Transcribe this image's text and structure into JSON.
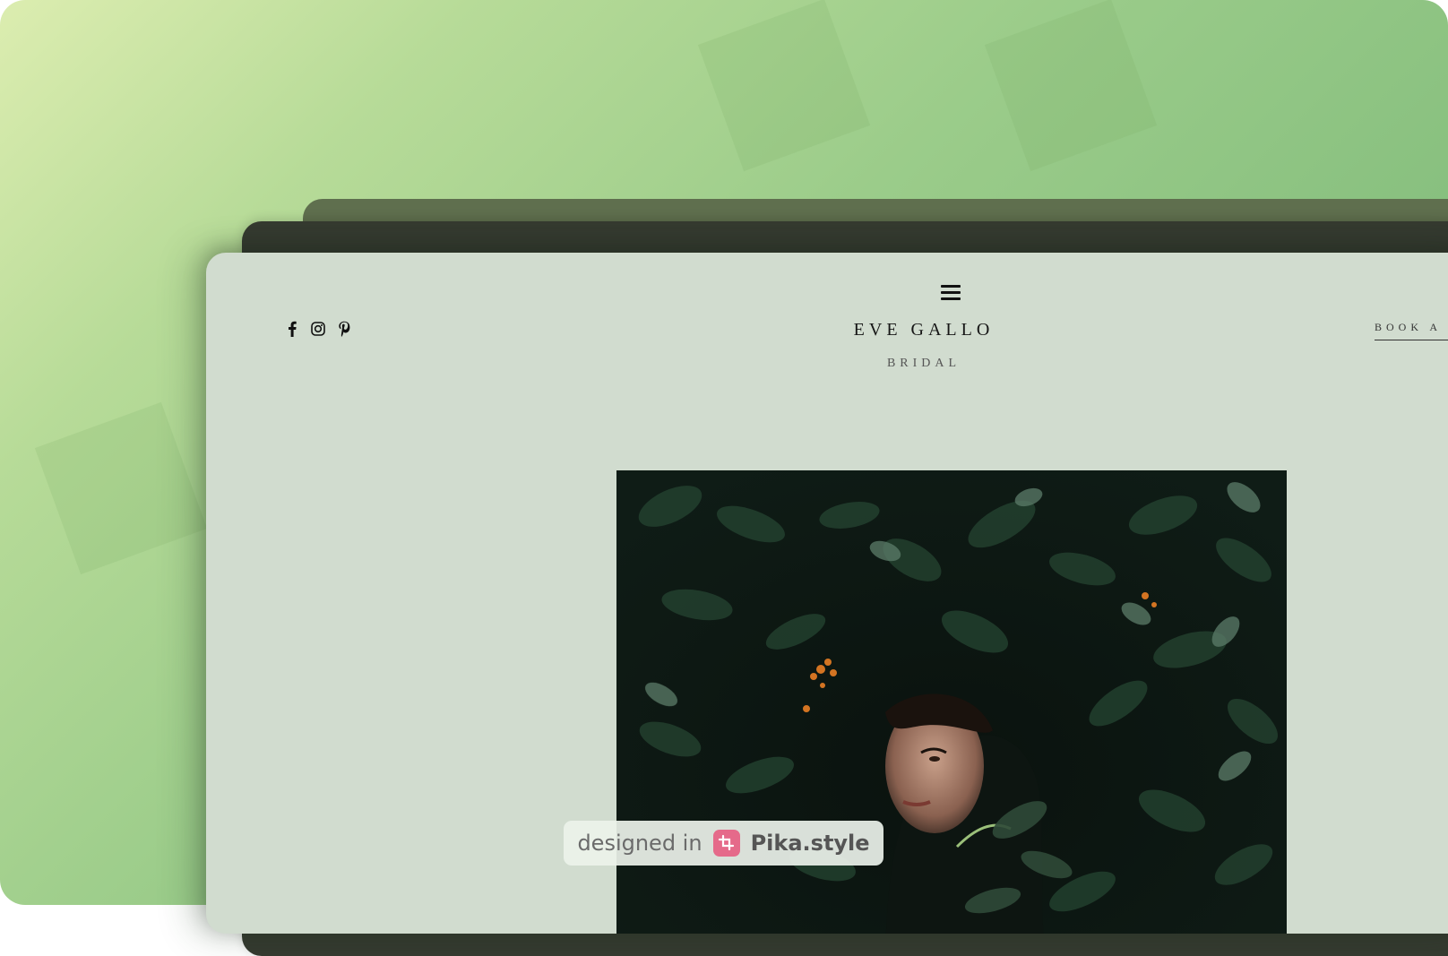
{
  "site": {
    "brand_name": "EVE GALLO",
    "brand_tagline": "BRIDAL",
    "cta_label": "BOOK A",
    "social": [
      {
        "name": "facebook",
        "icon": "facebook-icon"
      },
      {
        "name": "instagram",
        "icon": "instagram-icon"
      },
      {
        "name": "pinterest",
        "icon": "pinterest-icon"
      }
    ],
    "menu_icon": "hamburger-menu-icon",
    "hero_image": "woman-in-foliage-photo"
  },
  "watermark": {
    "prefix": "designed in",
    "brand": "Pika.style",
    "icon": "crop-icon"
  },
  "colors": {
    "page_bg": "#d1dccf",
    "frame_gradient_start": "#dcedb0",
    "frame_gradient_end": "#7bb777",
    "text": "#161616",
    "badge_logo": "#e56a8a"
  }
}
